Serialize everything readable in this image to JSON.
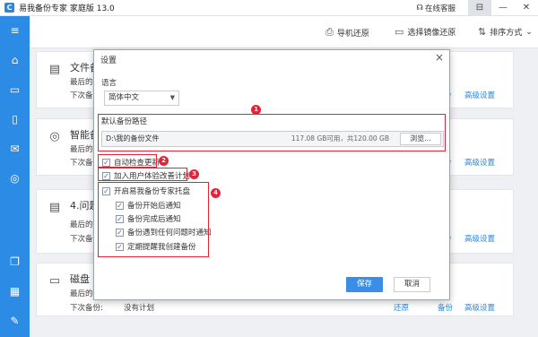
{
  "window": {
    "app_title": "易我备份专家 家庭版 13.0",
    "support": "在线客服",
    "controls": [
      "⊟",
      "—",
      "✕"
    ]
  },
  "sidebar": {
    "icons": [
      "menu-icon",
      "backup-icon",
      "disk-icon",
      "file-icon",
      "mail-icon",
      "smart-icon",
      "clone-icon",
      "tools-icon",
      "settings-icon"
    ]
  },
  "toolbar": {
    "restore": "导机还原",
    "mirror_restore": "选择镜像还原",
    "sort": "排序方式"
  },
  "cards": [
    {
      "title": "文件备",
      "line1": "最后的备",
      "line2": "下次备份",
      "links": [
        "份",
        "高级设置"
      ]
    },
    {
      "title": "智能备",
      "line1": "最后的备",
      "line2": "下次备份",
      "links": [
        "份",
        "高级设置"
      ]
    },
    {
      "title": "4.问题",
      "line1": "最后的备",
      "line2": "下次备份",
      "links": [
        "份",
        "高级设置"
      ]
    },
    {
      "title": "磁盘 2",
      "line1": "最后的备",
      "line2": "下次备份:",
      "line2_value": "没有计划",
      "links": [
        "还原",
        "备份",
        "高级设置"
      ]
    }
  ],
  "dialog": {
    "title": "设置",
    "language_label": "语言",
    "language_value": "简体中文",
    "backup_path_label": "默认备份路径",
    "backup_path": "D:\\我的备份文件",
    "disk_info": "117.08 GB可用，共120.00 GB",
    "browse": "浏览...",
    "auto_update": "自动检查更新",
    "ux_plan": "加入用户体验改善计划",
    "tray": "开启易我备份专家托盘",
    "notify_start": "备份开始后通知",
    "notify_done": "备份完成后通知",
    "notify_error": "备份遇到任何问题时通知",
    "remind": "定期提醒我创建备份",
    "save": "保存",
    "cancel": "取消",
    "markers": [
      "1",
      "2",
      "3",
      "4"
    ]
  }
}
